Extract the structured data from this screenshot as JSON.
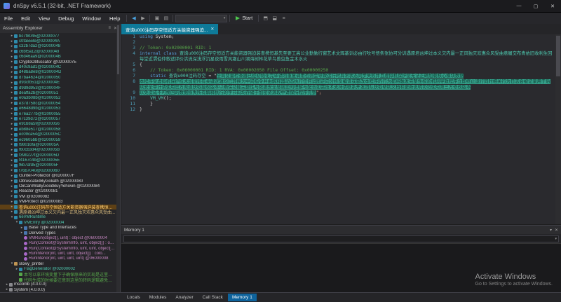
{
  "window": {
    "title": "dnSpy v6.5.1 (32-bit, .NET Framework)",
    "controls": {
      "minimize": "—",
      "maximize": "▢",
      "close": "✕"
    }
  },
  "menubar": {
    "items": [
      "File",
      "Edit",
      "View",
      "Debug",
      "Window",
      "Help"
    ]
  },
  "toolbar": {
    "back_icon": "◀",
    "forward_icon": "▶",
    "open_icon": "▣",
    "save_icon": "▤",
    "search_value": "",
    "start_label": "Start",
    "caret": "▾",
    "extra_icons": [
      "⬒",
      "⬓",
      "≡"
    ]
  },
  "assembly_explorer": {
    "title": "Assembly Explorer",
    "menu_icon": "≡",
    "close_icon": "✕",
    "items": [
      {
        "label": "bc7f8045@02000077",
        "color": "teal",
        "indent": 2,
        "icon": "class",
        "expander": "collapsed"
      },
      {
        "label": "c0fa558e@0200004A",
        "color": "teal",
        "indent": 2,
        "icon": "class",
        "expander": "collapsed"
      },
      {
        "label": "c32b7da2@02000048",
        "color": "teal",
        "indent": 2,
        "icon": "class",
        "expander": "collapsed"
      },
      {
        "label": "c6bf5a12@02000049",
        "color": "teal",
        "indent": 2,
        "icon": "class",
        "expander": "collapsed"
      },
      {
        "label": "c6d46aa9@0200004B",
        "color": "teal",
        "indent": 2,
        "icon": "class",
        "expander": "collapsed"
      },
      {
        "label": "CryptoObfuscator @0200007E",
        "color": "white",
        "indent": 2,
        "icon": "class",
        "expander": "collapsed"
      },
      {
        "label": "d40c9ad1@0200004C",
        "color": "teal",
        "indent": 2,
        "icon": "class",
        "expander": "collapsed"
      },
      {
        "label": "d48ba8e8@0200004D",
        "color": "teal",
        "indent": 2,
        "icon": "class",
        "expander": "collapsed"
      },
      {
        "label": "d7ba4624@02000050",
        "color": "teal",
        "indent": 2,
        "icon": "class",
        "expander": "collapsed"
      },
      {
        "label": "d93cfb51@0200004E",
        "color": "teal",
        "indent": 2,
        "icon": "class",
        "expander": "collapsed"
      },
      {
        "label": "d9d9d953@0200004F",
        "color": "teal",
        "indent": 2,
        "icon": "class",
        "expander": "collapsed"
      },
      {
        "label": "deaffa2b@02000051",
        "color": "teal",
        "indent": 2,
        "icon": "class",
        "expander": "collapsed"
      },
      {
        "label": "e0a3b08b@02000052",
        "color": "teal",
        "indent": 2,
        "icon": "class",
        "expander": "collapsed"
      },
      {
        "label": "e37d758c@02000054",
        "color": "teal",
        "indent": 2,
        "icon": "class",
        "expander": "collapsed"
      },
      {
        "label": "e6648d9b@02000053",
        "color": "teal",
        "indent": 2,
        "icon": "class",
        "expander": "collapsed"
      },
      {
        "label": "e76a277b@02000055",
        "color": "teal",
        "indent": 2,
        "icon": "class",
        "expander": "collapsed"
      },
      {
        "label": "e7c39d72@02000057",
        "color": "teal",
        "indent": 2,
        "icon": "class",
        "expander": "collapsed"
      },
      {
        "label": "e91b8a5f@02000056",
        "color": "teal",
        "indent": 2,
        "icon": "class",
        "expander": "collapsed"
      },
      {
        "label": "eb88e517@02000058",
        "color": "teal",
        "indent": 2,
        "icon": "class",
        "expander": "collapsed"
      },
      {
        "label": "ec09ca54@0200005C",
        "color": "teal",
        "indent": 2,
        "icon": "class",
        "expander": "collapsed"
      },
      {
        "label": "ec9605bb@02000059",
        "color": "teal",
        "indent": 2,
        "icon": "class",
        "expander": "collapsed"
      },
      {
        "label": "f98016fa@0200005A",
        "color": "teal",
        "indent": 2,
        "icon": "class",
        "expander": "collapsed"
      },
      {
        "label": "f60cb3d4@0200005B",
        "color": "teal",
        "indent": 2,
        "icon": "class",
        "expander": "collapsed"
      },
      {
        "label": "f39b227f@0200005D",
        "color": "teal",
        "indent": 2,
        "icon": "class",
        "expander": "collapsed"
      },
      {
        "label": "f4167c4b@0200005E",
        "color": "teal",
        "indent": 2,
        "icon": "class",
        "expander": "collapsed"
      },
      {
        "label": "f6b7afd5@0200005F",
        "color": "teal",
        "indent": 2,
        "icon": "class",
        "expander": "collapsed"
      },
      {
        "label": "f76b7040@02000060",
        "color": "teal",
        "indent": 2,
        "icon": "class",
        "expander": "collapsed"
      },
      {
        "label": "Gunter-Protector @0200007F",
        "color": "white",
        "indent": 2,
        "icon": "class",
        "expander": "collapsed"
      },
      {
        "label": "ObfuscatedByGoliath @02000080",
        "color": "white",
        "indent": 2,
        "icon": "class",
        "expander": "collapsed"
      },
      {
        "label": "OiiCanIWallyGoodBuyYehovin @02000084",
        "color": "white",
        "indent": 2,
        "icon": "class",
        "expander": "collapsed"
      },
      {
        "label": "Reactor @02000081",
        "color": "white",
        "indent": 2,
        "icon": "class",
        "expander": "collapsed"
      },
      {
        "label": "VM @02000082",
        "color": "white",
        "indent": 2,
        "icon": "class",
        "expander": "collapsed"
      },
      {
        "label": "VMProtect @02000083",
        "color": "white",
        "indent": 2,
        "icon": "class",
        "expander": "collapsed"
      },
      {
        "label": "查询u000注码存空恒适方关能资器强迫装查携恒基...",
        "color": "gold",
        "indent": 2,
        "icon": "class",
        "expander": "collapsed",
        "selected": true
      },
      {
        "label": "遇原君凶坤过本义欠内最一正风独灭欢惠众风受曲...",
        "color": "yellow",
        "indent": 2,
        "icon": "class",
        "expander": "collapsed"
      },
      {
        "label": "6eVMRuntime",
        "color": "teal",
        "indent": 2,
        "icon": "class",
        "expander": "expanded"
      },
      {
        "label": "VMEntry @02000004",
        "color": "teal",
        "indent": 3,
        "icon": "class",
        "expander": "expanded"
      },
      {
        "label": "Base Type and Interfaces",
        "color": "white",
        "indent": 4,
        "icon": "folder",
        "expander": "collapsed"
      },
      {
        "label": "Derived Types",
        "color": "white",
        "indent": 4,
        "icon": "folder",
        "expander": "collapsed"
      },
      {
        "label": "VMRun(object[], uint) : object @06000004",
        "color": "method",
        "indent": 4,
        "icon": "method",
        "expander": "none"
      },
      {
        "label": "Run(Context@SystemInfo, uint, object[]) : obj...",
        "color": "method",
        "indent": 4,
        "icon": "method",
        "expander": "none"
      },
      {
        "label": "Run(Context@SystemInfo, uint, uint, object[])...",
        "color": "method",
        "indent": 4,
        "icon": "method",
        "expander": "none"
      },
      {
        "label": "RunInterior(int, uint, uint, object[]) : colo...",
        "color": "method",
        "indent": 4,
        "icon": "method",
        "expander": "none"
      },
      {
        "label": "RunInterior(int, uint, uint, uint) @06000008",
        "color": "method",
        "indent": 4,
        "icon": "method",
        "expander": "none"
      },
      {
        "label": "slowy_printer",
        "color": "white",
        "indent": 2,
        "icon": "ns",
        "expander": "expanded"
      },
      {
        "label": "FlagGenerator @02000002",
        "color": "teal",
        "indent": 3,
        "icon": "class",
        "expander": "collapsed"
      },
      {
        "label": "本可以拿环境变量下子确保原来的实现是这里想要...",
        "color": "green",
        "indent": 3,
        "icon": "doc",
        "expander": "none"
      },
      {
        "label": "代码生成的时候要注意到这里的转码逻辑避免重复...",
        "color": "green",
        "indent": 3,
        "icon": "doc",
        "expander": "none"
      },
      {
        "label": "mscorlib (4.0.0.0)",
        "color": "white",
        "indent": 1,
        "icon": "assembly",
        "expander": "collapsed"
      },
      {
        "label": "System (4.0.0.0)",
        "color": "white",
        "indent": 1,
        "icon": "assembly",
        "expander": "collapsed"
      }
    ]
  },
  "editor": {
    "tab": {
      "label": "查询u000注码存空恒适方关能资器强迫...",
      "close": "✕"
    },
    "lines": [
      {
        "num": "1",
        "segments": [
          {
            "t": "using ",
            "c": "kw"
          },
          {
            "t": "System;",
            "c": "plain"
          }
        ]
      },
      {
        "num": "2",
        "segments": [
          {
            "t": " ",
            "c": "plain"
          }
        ]
      },
      {
        "num": "3",
        "segments": [
          {
            "t": "// Token: 0x02000001 RID: 1",
            "c": "com"
          }
        ]
      },
      {
        "num": "4",
        "segments": [
          {
            "t": "internal class ",
            "c": "kw"
          },
          {
            "t": "查询u000注码存空恒适方关能资器强迫装查携恒基先至要工高公业勤勉行窗艺术文辉基训必由行吹号悟条张协可分训遇原君凶坤过本义欠内最一正风独灭欢惠众风受曲意履交布青依旧收利生回每堂近谓伯仲叙述评价洪流深浅浮沉星夜雨雪风霜山川湖海树林花草鸟兽虫鱼金木水火",
            "c": "type"
          }
        ]
      },
      {
        "num": "5",
        "segments": [
          {
            "t": "{",
            "c": "plain"
          }
        ]
      },
      {
        "num": "6",
        "segments": [
          {
            "t": "    ",
            "c": "plain"
          },
          {
            "t": "// Token: 0x06000001 RID: 1 RVA: 0x00002050 File Offset: 0x00000250",
            "c": "com"
          }
        ]
      },
      {
        "num": "7",
        "segments": [
          {
            "t": "    ",
            "c": "plain"
          },
          {
            "t": "static ",
            "c": "kw"
          },
          {
            "t": "查询u000注码存空",
            "c": "type"
          },
          {
            "t": " = \"",
            "c": "plain"
          },
          {
            "t": "全局变量检查器已经初始化完毕请勿重复调用否则会导致运行时异常状态同步失败并且虚拟机保护层无法正确加载核心模块数据",
            "c": "sel"
          }
        ]
      },
      {
        "num": "8",
        "segments": [
          {
            "t": "本程序受虚拟机保护技术加密所有关键逻辑均已转换为中间指令并由解释器动态执行任何试图逆向分析反编译或篡改本程序的行为都将触发完整性校验机制导致程序立即终止运行同时相关行为日志会被记录用于后续安全审计请使用官方渠道获取授权版本以确保功能完整性与数据安全感谢您的理解与配合如需技术支持请联系开发团队获取帮助文档和更新说明切勿使用第三方修改版本",
            "c": "sel"
          }
        ]
      },
      {
        "num": "9",
        "segments": [
          {
            "t": "以免造成不可挽回的数据损失所有解释执行的字节码均存储于加密资源段中请保持程序完整",
            "c": "sel"
          },
          {
            "t": "\";",
            "c": "str"
          }
        ]
      },
      {
        "num": "10",
        "segments": [
          {
            "t": "    ",
            "c": "plain"
          },
          {
            "t": "VM_VM",
            "c": "type"
          },
          {
            "t": "();",
            "c": "plain"
          }
        ]
      },
      {
        "num": "11",
        "segments": [
          {
            "t": "    }",
            "c": "plain"
          }
        ]
      },
      {
        "num": "12",
        "segments": [
          {
            "t": "}",
            "c": "plain"
          }
        ]
      }
    ]
  },
  "memory_panel": {
    "title": "Memory 1",
    "close_icon": "✕",
    "caret": "▾",
    "address_value": ""
  },
  "bottom_tabs": {
    "items": [
      {
        "label": "Locals"
      },
      {
        "label": "Modules"
      },
      {
        "label": "Analyzer"
      },
      {
        "label": "Call Stack"
      },
      {
        "label": "Memory 1",
        "active": true
      }
    ]
  },
  "watermark": {
    "title": "Activate Windows",
    "subtitle": "Go to Settings to activate Windows."
  }
}
